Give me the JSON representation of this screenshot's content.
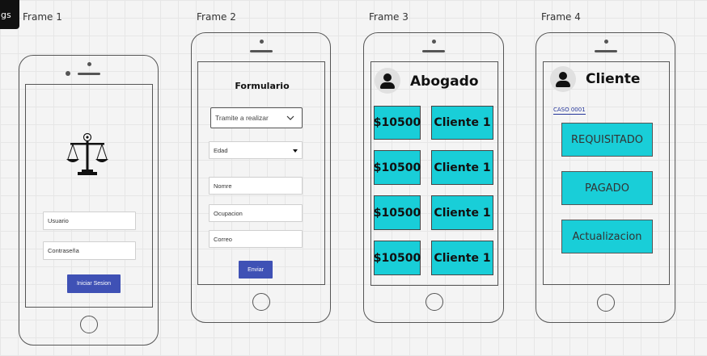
{
  "badge": "gs",
  "frames": [
    {
      "label": "Frame 1"
    },
    {
      "label": "Frame 2"
    },
    {
      "label": "Frame 3"
    },
    {
      "label": "Frame 4"
    }
  ],
  "frame1": {
    "usuario_placeholder": "Usuario",
    "password_placeholder": "Contraseña",
    "login_button": "Iniciar Sesion"
  },
  "frame2": {
    "title": "Formulario",
    "tramite_select": "Tramite a realizar",
    "edad_select": "Edad",
    "nombre_field": "Nomre",
    "ocupacion_field": "Ocupacion",
    "correo_field": "Correo",
    "submit_button": "Enviar"
  },
  "frame3": {
    "title": "Abogado",
    "rows": [
      {
        "amount": "$10500",
        "client": "Cliente 1"
      },
      {
        "amount": "$10500",
        "client": "Cliente 1"
      },
      {
        "amount": "$10500",
        "client": "Cliente 1"
      },
      {
        "amount": "$10500",
        "client": "Cliente 1"
      }
    ]
  },
  "frame4": {
    "title": "Cliente",
    "case_link": "CASO 0001",
    "statuses": [
      "REQUISITADO",
      "PAGADO",
      "Actualizacion"
    ]
  },
  "colors": {
    "accent_blue": "#3f51b5",
    "tile_cyan": "#19ced8",
    "outline": "#555555"
  }
}
